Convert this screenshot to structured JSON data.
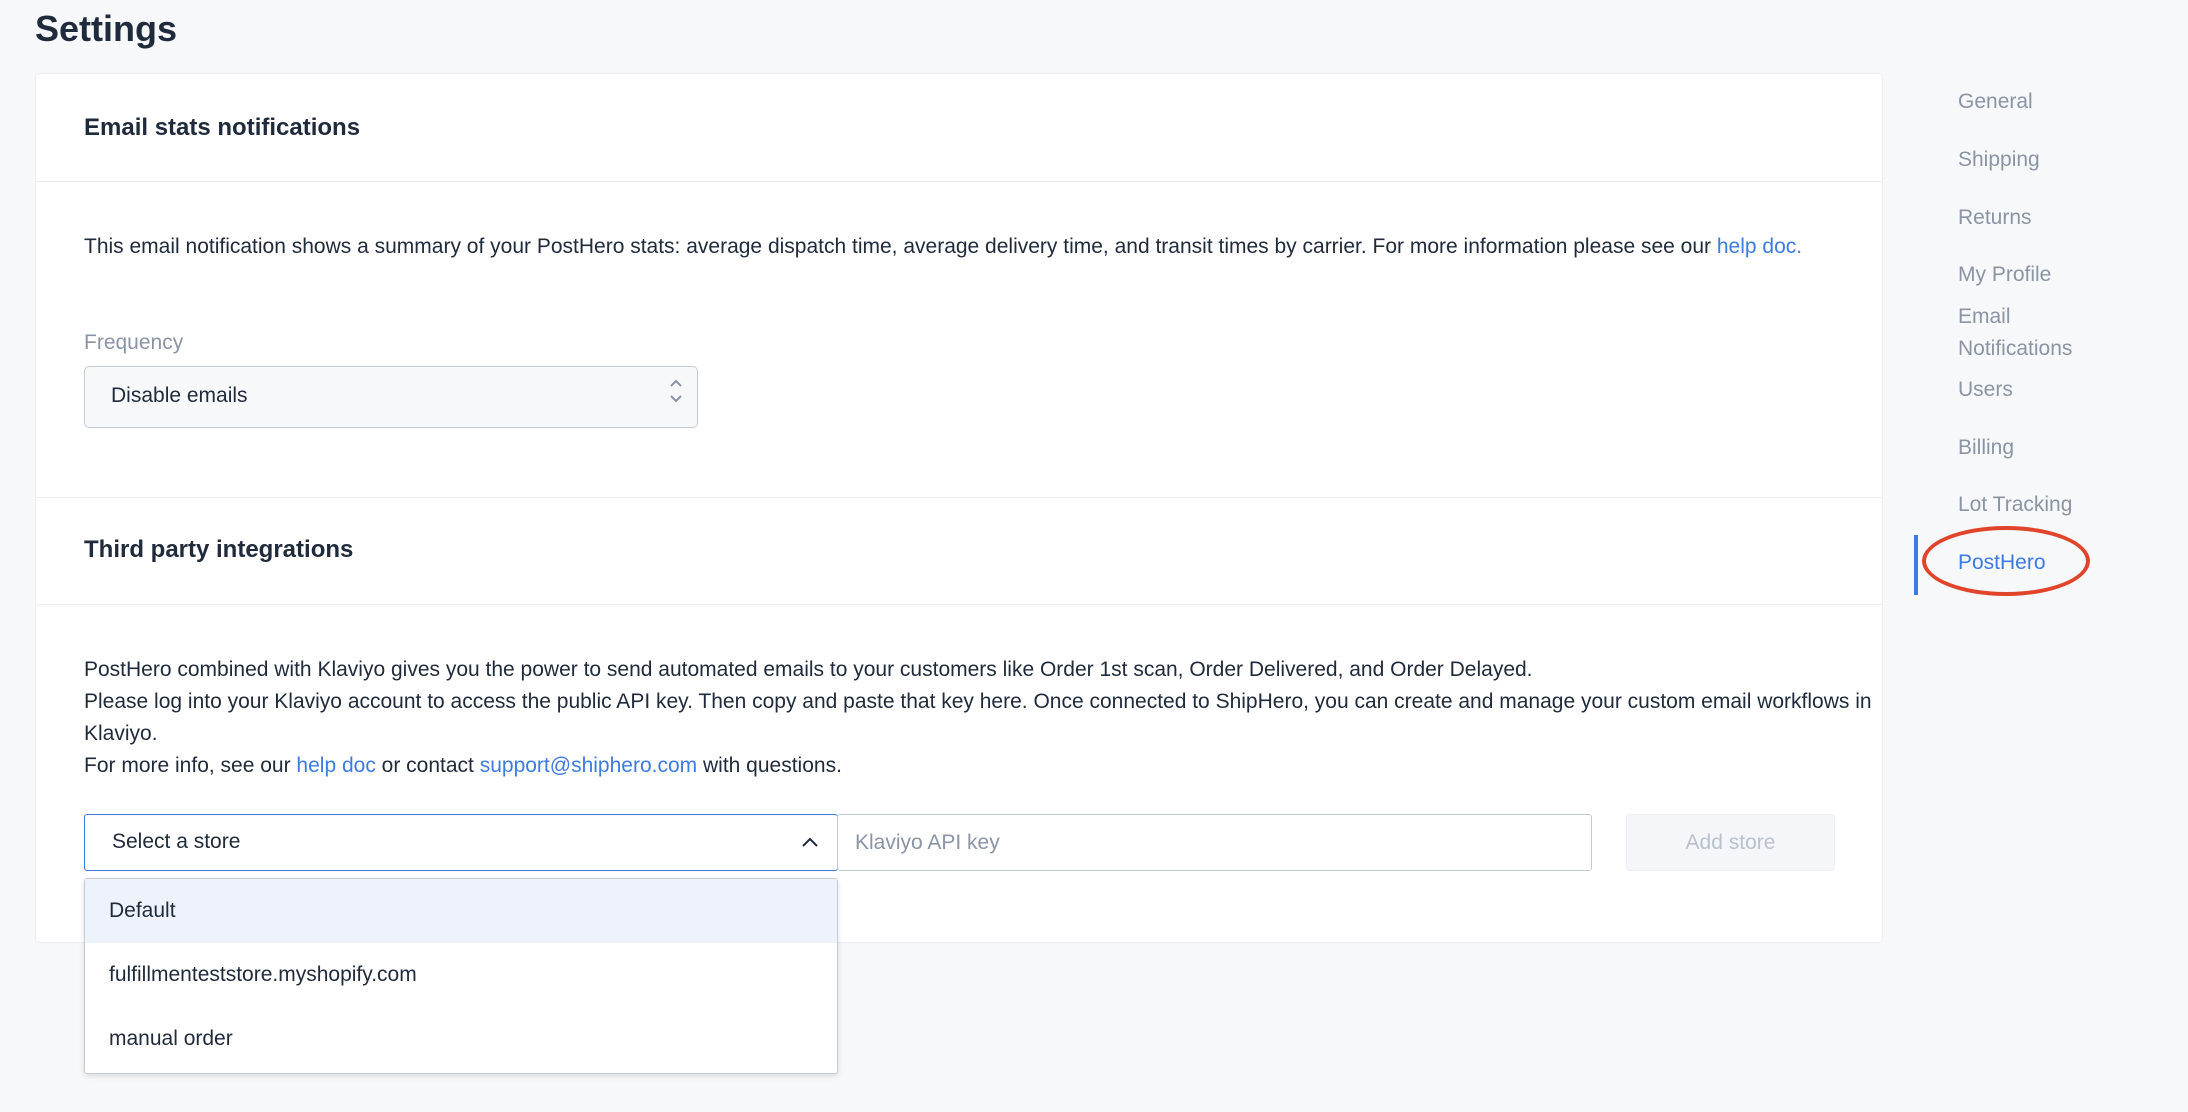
{
  "page": {
    "title": "Settings"
  },
  "email_stats": {
    "title": "Email stats notifications",
    "description": "This email notification shows a summary of your PostHero stats: average dispatch time, average delivery time, and transit times by carrier. For more information please see our ",
    "help_link": "help doc.",
    "frequency_label": "Frequency",
    "frequency_value": "Disable emails"
  },
  "integrations": {
    "title": "Third party integrations",
    "line1": "PostHero combined with Klaviyo gives you the power to send automated emails to your customers like Order 1st scan, Order Delivered, and Order Delayed.",
    "line2": "Please log into your Klaviyo account to access the public API key. Then copy and paste that key here. Once connected to ShipHero, you can create and manage your custom email workflows in Klaviyo.",
    "line3_prefix": "For more info, see our ",
    "line3_help_link": "help doc",
    "line3_mid": " or contact ",
    "line3_email": "support@shiphero.com",
    "line3_suffix": " with questions.",
    "store_select_placeholder": "Select a store",
    "api_key_placeholder": "Klaviyo API key",
    "add_store_label": "Add store",
    "store_options": [
      "Default",
      "fulfillmenteststore.myshopify.com",
      "manual order"
    ]
  },
  "side_nav": {
    "items": [
      "General",
      "Shipping",
      "Returns",
      "My Profile",
      "Email Notifications",
      "Users",
      "Billing",
      "Lot Tracking",
      "PostHero"
    ],
    "active": "PostHero"
  },
  "colors": {
    "accent": "#3d7be0",
    "annotation": "#e0452b"
  }
}
